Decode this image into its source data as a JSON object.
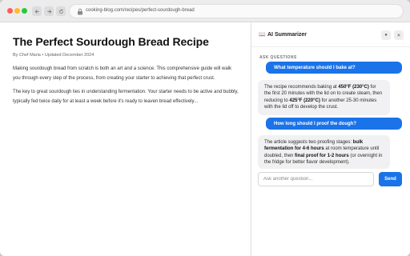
{
  "browser": {
    "url": "cooking-blog.com/recipes/perfect-sourdough-bread"
  },
  "article": {
    "title": "The Perfect Sourdough Bread Recipe",
    "byline": "By Chef Maria • Updated December 2024",
    "paragraphs": [
      "Making sourdough bread from scratch is both an art and a science. This comprehensive guide will walk you through every step of the process, from creating your starter to achieving that perfect crust.",
      "The key to great sourdough lies in understanding fermentation. Your starter needs to be active and bubbly, typically fed twice daily for at least a week before it's ready to leaven bread effectively..."
    ]
  },
  "panel": {
    "icon": "book-icon",
    "title": "AI Summarizer",
    "section_label": "ASK QUESTIONS",
    "messages": [
      {
        "role": "user",
        "text": "What temperature should I bake at?"
      },
      {
        "role": "assistant",
        "parts": [
          {
            "text": "The recipe recommends baking at ",
            "bold": false
          },
          {
            "text": "450°F (230°C)",
            "bold": true
          },
          {
            "text": " for the first 20 minutes with the lid on to create steam, then reducing to ",
            "bold": false
          },
          {
            "text": "425°F (220°C)",
            "bold": true
          },
          {
            "text": " for another 25-30 minutes with the lid off to develop the crust.",
            "bold": false
          }
        ]
      },
      {
        "role": "user",
        "text": "How long should I proof the dough?"
      },
      {
        "role": "assistant",
        "parts": [
          {
            "text": "The article suggests two proofing stages: ",
            "bold": false
          },
          {
            "text": "bulk fermentation for 4-6 hours",
            "bold": true
          },
          {
            "text": " at room temperature until doubled, then ",
            "bold": false
          },
          {
            "text": "final proof for 1-2 hours",
            "bold": true
          },
          {
            "text": " (or overnight in the fridge for better flavor development).",
            "bold": false
          }
        ]
      }
    ],
    "input_placeholder": "Ask another question...",
    "send_label": "Send"
  },
  "colors": {
    "accent": "#1a73e8",
    "assistant_bubble": "#f1f1f3"
  }
}
